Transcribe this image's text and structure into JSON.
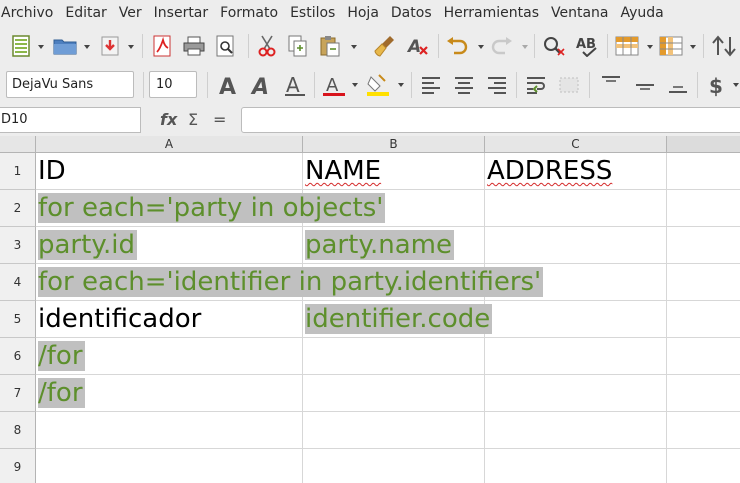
{
  "menu": [
    "Archivo",
    "Editar",
    "Ver",
    "Insertar",
    "Formato",
    "Estilos",
    "Hoja",
    "Datos",
    "Herramientas",
    "Ventana",
    "Ayuda"
  ],
  "toolbar": {
    "font_name": "DejaVu Sans",
    "font_size": "10"
  },
  "formula_bar": {
    "cell_ref": "D10",
    "fx_label": "fx",
    "sum_label": "Σ",
    "equals_label": "=",
    "formula_value": ""
  },
  "sheet": {
    "columns": [
      "A",
      "B",
      "C"
    ],
    "rows": [
      "1",
      "2",
      "3",
      "4",
      "5",
      "6",
      "7",
      "8",
      "9"
    ],
    "cells": {
      "A1": "ID",
      "B1": "NAME",
      "C1": "ADDRESS",
      "A2": "for each='party in objects'",
      "A3": "party.id",
      "B3": "party.name",
      "A4": "for each='identifier in party.identifiers'",
      "A5": "identificador",
      "B5": "identifier.code",
      "A6": "/for",
      "A7": "/for"
    }
  },
  "colors": {
    "template_text": "#5d8f2c",
    "highlight": "#c0c0c0",
    "spellcheck": "#d42a2a"
  }
}
